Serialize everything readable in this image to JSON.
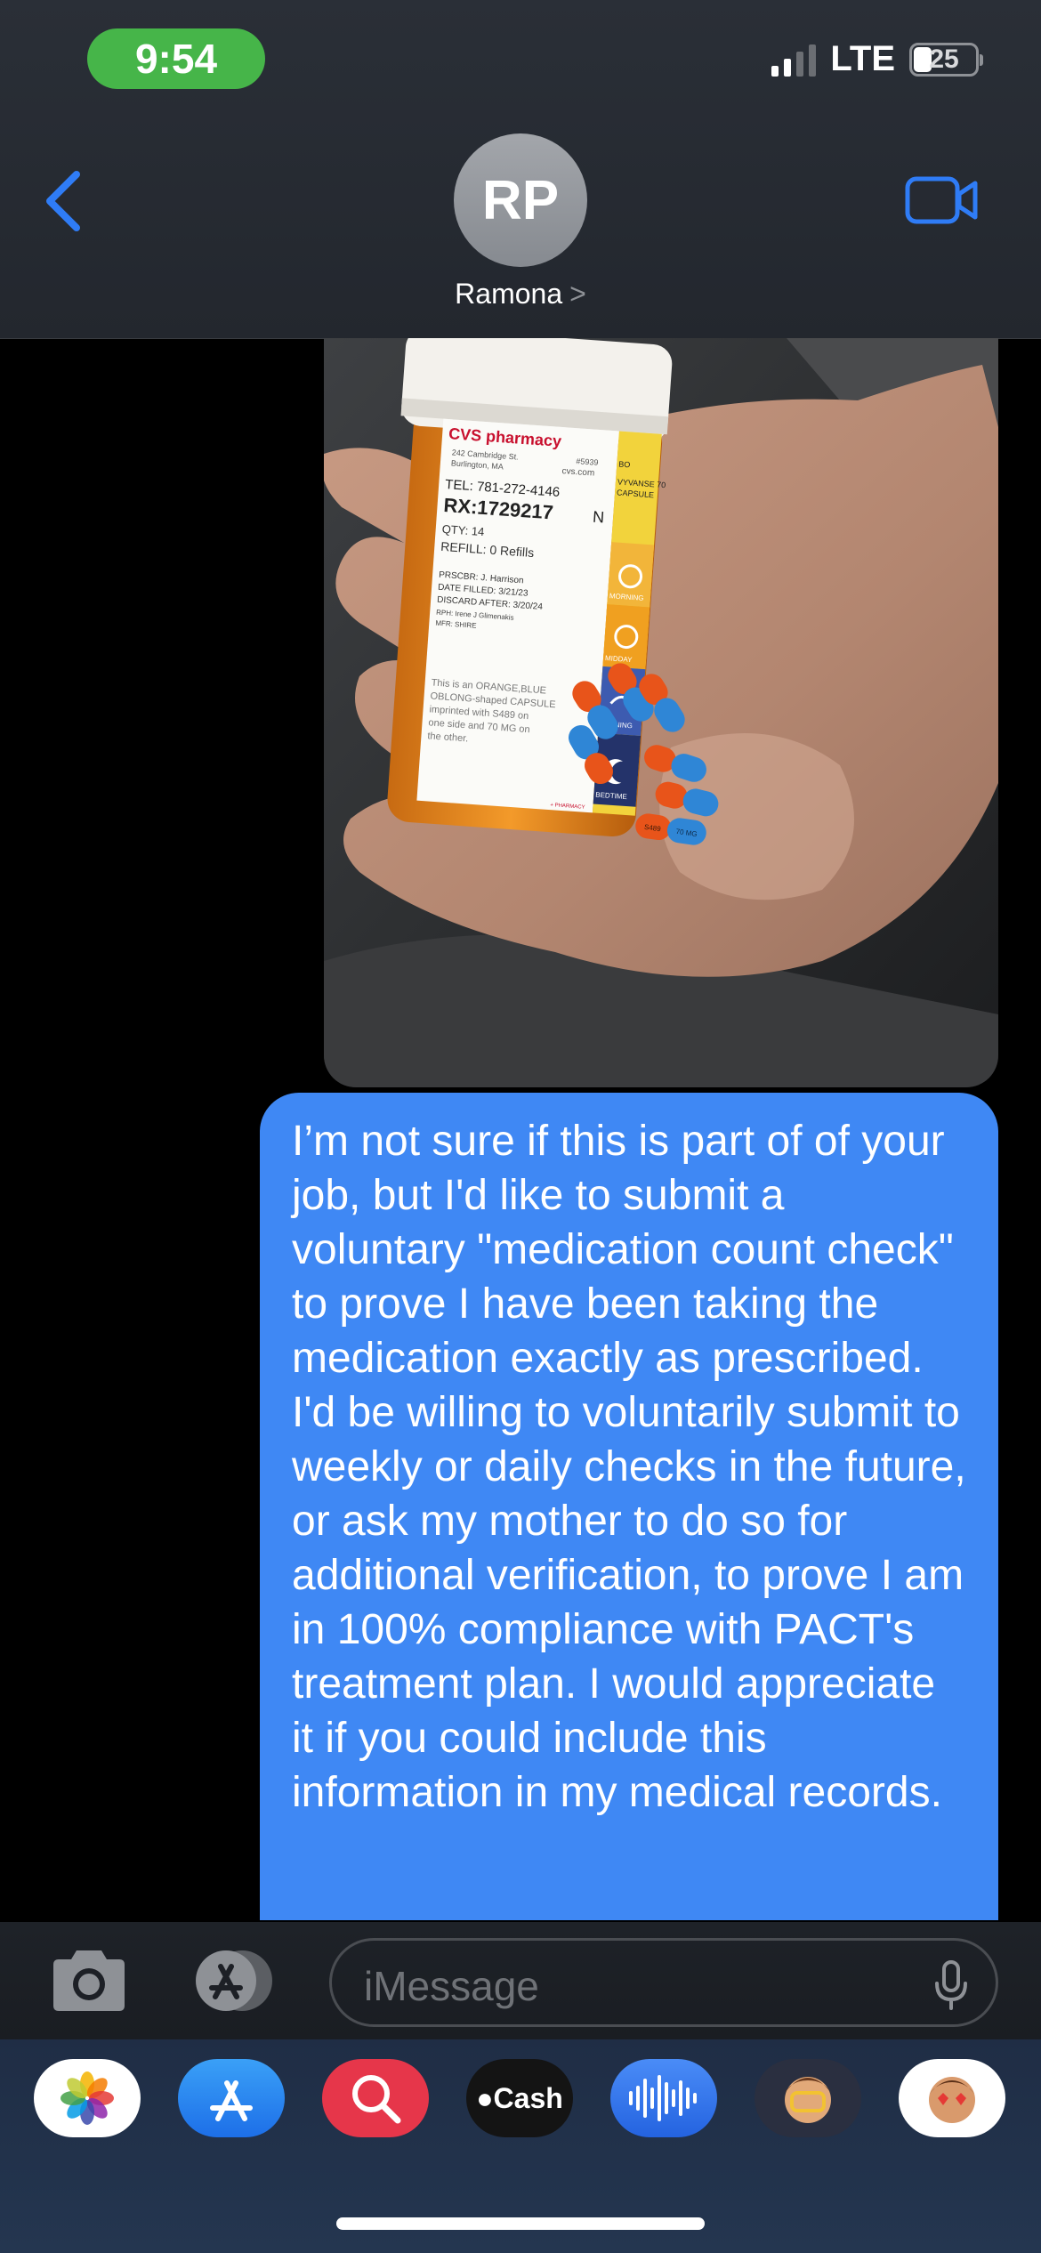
{
  "status_bar": {
    "time": "9:54",
    "network": "LTE",
    "battery": "25"
  },
  "header": {
    "avatar_initials": "RP",
    "contact_name": "Ramona",
    "contact_chevron": ">"
  },
  "photo": {
    "label_pharmacy": "CVS pharmacy",
    "label_address_1": "242 Cambridge St.",
    "label_address_2": "Burlington, MA",
    "label_store": "#5939",
    "label_site": "cvs.com",
    "label_tel": "TEL: 781-272-4146",
    "label_rx": "RX:1729217",
    "label_rx_flag": "N",
    "label_qty": "QTY: 14",
    "label_refill": "REFILL: 0 Refills",
    "label_prescriber": "PRSCBR: J. Harrison",
    "label_filled": "DATE FILLED: 3/21/23",
    "label_discard": "DISCARD AFTER: 3/20/24",
    "label_rph": "RPH: Irene J Glimenakis",
    "label_mfr": "MFR: SHIRE",
    "label_desc_1": "This is an ORANGE,BLUE",
    "label_desc_2": "OBLONG-shaped CAPSULE",
    "label_desc_3": "imprinted with S489 on",
    "label_desc_4": "one side and 70 MG on",
    "label_desc_5": "the other.",
    "label_drug": "VYVANSE 70",
    "label_drug_2": "CAPSULE",
    "label_bo": "BO",
    "label_morning": "MORNING",
    "label_midday": "MIDDAY",
    "label_evening": "EVENING",
    "label_bedtime": "BEDTIME",
    "label_footer": "+ PHARMACY",
    "capsule_imprint_1": "S489",
    "capsule_imprint_2": "70 MG"
  },
  "message": {
    "text": "I’m not sure if this is part of of your job, but I'd like to submit a voluntary \"medication count check\" to prove I have been taking the medication exactly as prescribed. I'd be willing to voluntarily submit to weekly or daily checks in the future, or ask my mother to do so for additional verification, to prove I am in 100% compliance with PACT's treatment plan. I would appreciate it if you could include this information in my medical records."
  },
  "input": {
    "placeholder": "iMessage"
  },
  "drawer": {
    "cash_label": "Cash"
  },
  "colors": {
    "bubble": "#3f88f4",
    "accent": "#2f7cf6",
    "time_pill": "#46b549"
  }
}
